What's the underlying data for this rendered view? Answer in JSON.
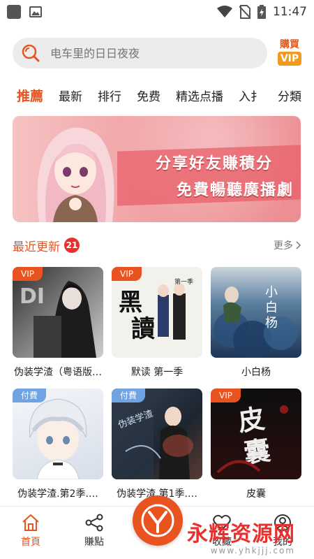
{
  "status_bar": {
    "time": "11:47"
  },
  "search": {
    "placeholder": "电车里的日日夜夜"
  },
  "vip_badge": {
    "top": "購買",
    "bottom": "VIP"
  },
  "tabs": [
    {
      "label": "推薦",
      "active": true
    },
    {
      "label": "最新"
    },
    {
      "label": "排行"
    },
    {
      "label": "免费"
    },
    {
      "label": "精选点播"
    },
    {
      "label": "入扌"
    },
    {
      "label": "分類"
    }
  ],
  "banner": {
    "line1": "分享好友賺積分",
    "line2": "免費暢聽廣播劇"
  },
  "section": {
    "title": "最近更新",
    "count": "21",
    "more": "更多"
  },
  "cards": [
    {
      "title": "伪装学渣（粤语版…",
      "tag": "VIP",
      "tag_type": "vip",
      "cover_colors": [
        "#3a3a3a",
        "#9a9a9a"
      ]
    },
    {
      "title": "默读 第一季",
      "tag": "VIP",
      "tag_type": "vip",
      "cover_colors": [
        "#f1efe8",
        "#2a2a2a"
      ]
    },
    {
      "title": "小白杨",
      "tag": "",
      "tag_type": "",
      "cover_colors": [
        "#1f3a5c",
        "#7fa9c6"
      ]
    },
    {
      "title": "伪装学渣.第2季.…",
      "tag": "付費",
      "tag_type": "paid",
      "cover_colors": [
        "#e9eef5",
        "#b9c7d8"
      ]
    },
    {
      "title": "伪装学渣.第1季.…",
      "tag": "付費",
      "tag_type": "paid",
      "cover_colors": [
        "#2b3440",
        "#7a4a3a"
      ]
    },
    {
      "title": "皮囊",
      "tag": "VIP",
      "tag_type": "vip",
      "cover_colors": [
        "#151515",
        "#5a1a1a"
      ]
    }
  ],
  "bottom_nav": [
    {
      "label": "首頁",
      "icon": "home-icon",
      "active": true
    },
    {
      "label": "賺點",
      "icon": "share-icon",
      "active": false
    },
    {
      "label": "收藏",
      "icon": "heart-icon",
      "active": false
    },
    {
      "label": "我的",
      "icon": "user-icon",
      "active": false
    }
  ],
  "watermark": {
    "main": "永辉资源网",
    "sub": "www.yhkjjj.com"
  },
  "colors": {
    "accent": "#e8531f",
    "paid": "#6fa3e2",
    "badge": "#e8312f"
  }
}
